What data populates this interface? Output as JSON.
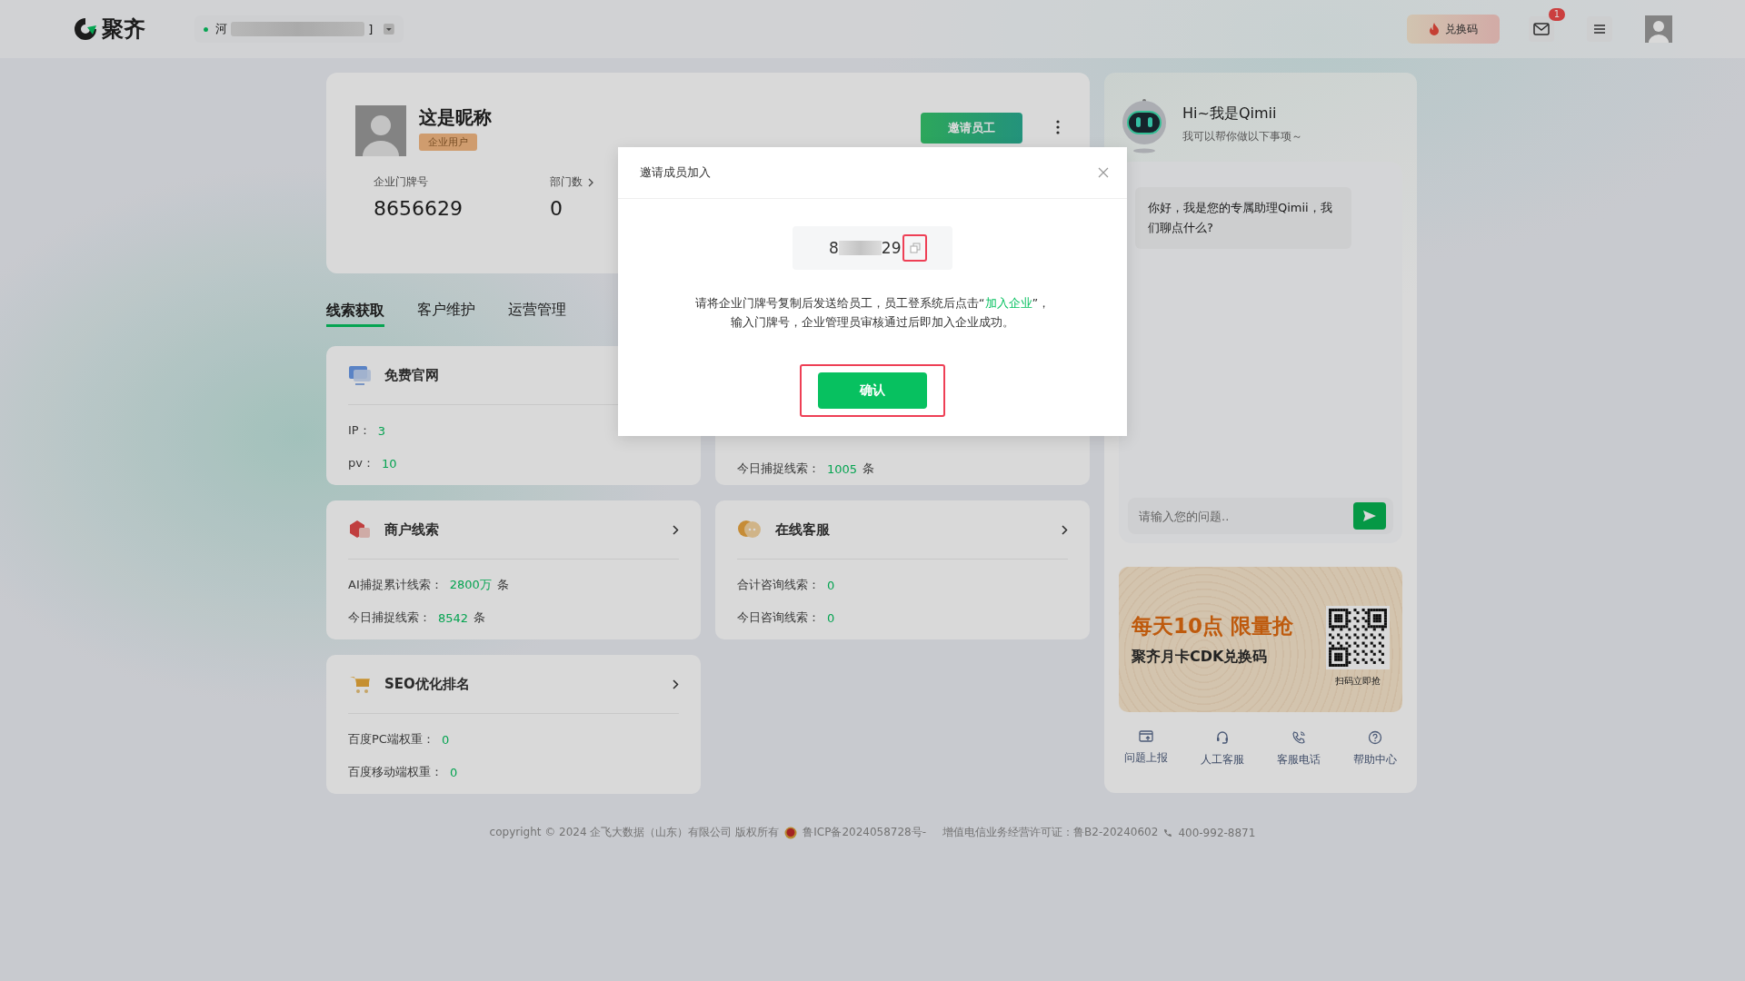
{
  "topbar": {
    "brand": "聚齐",
    "company": {
      "prefix": "河",
      "suffix": "]",
      "redacted": true
    },
    "redeem_button": "兑换码",
    "mail_badge": "1"
  },
  "profile": {
    "name": "这是昵称",
    "badge": "企业用户",
    "invite_button": "邀请员工",
    "stats": [
      {
        "label": "企业门牌号",
        "value": "8656629",
        "kind": "copy"
      },
      {
        "label": "部门数",
        "value": "0",
        "kind": "link"
      }
    ]
  },
  "tabs": [
    {
      "label": "线索获取",
      "selected": true
    },
    {
      "label": "客户维护",
      "selected": false
    },
    {
      "label": "运营管理",
      "selected": false
    }
  ],
  "cards": [
    {
      "title": "免费官网",
      "rows": [
        {
          "label": "IP：",
          "value": "3"
        },
        {
          "label": "pv：",
          "value": "10"
        }
      ]
    },
    {
      "rows": [
        {
          "label": "今日捕捉线索：",
          "value": "1005",
          "unit": "条"
        }
      ]
    },
    {
      "title": "商户线索",
      "chevron": true,
      "rows": [
        {
          "label": "AI捕捉累计线索：",
          "value": "2800万",
          "unit": "条"
        },
        {
          "label": "今日捕捉线索：",
          "value": "8542",
          "unit": "条"
        }
      ]
    },
    {
      "title": "在线客服",
      "chevron": true,
      "rows": [
        {
          "label": "合计咨询线索：",
          "value": "0"
        },
        {
          "label": "今日咨询线索：",
          "value": "0"
        }
      ]
    },
    {
      "title": "SEO优化排名",
      "chevron": true,
      "rows": [
        {
          "label": "百度PC端权重：",
          "value": "0"
        },
        {
          "label": "百度移动端权重：",
          "value": "0"
        }
      ]
    }
  ],
  "assistant": {
    "title": "Hi~我是Qimii",
    "subtitle": "我可以帮你做以下事项～",
    "message": "你好，我是您的专属助理Qimii，我们聊点什么?",
    "input": {
      "placeholder": "请输入您的问题.."
    },
    "banner": {
      "headline": "每天10点 限量抢",
      "subline": "聚齐月卡CDK兑换码",
      "qr_caption": "扫码立即抢"
    },
    "links": [
      {
        "label": "问题上报"
      },
      {
        "label": "人工客服"
      },
      {
        "label": "客服电话"
      },
      {
        "label": "帮助中心"
      }
    ]
  },
  "footer": {
    "copyright": "copyright © 2024 企飞大数据（山东）有限公司 版权所有",
    "icp": "鲁ICP备2024058728号-",
    "license": "增值电信业务经营许可证：鲁B2-20240602",
    "phone": "400-992-8871"
  },
  "dialog": {
    "title": "邀请成员加入",
    "code_start": "8",
    "code_end": "29",
    "code_redacted": true,
    "text_before": "请将企业门牌号复制后发送给员工，员工登系统后点击“",
    "link": "加入企业",
    "text_after": "”，",
    "text_line2": "输入门牌号，企业管理员审核通过后即加入企业成功。",
    "confirm_button": "确认",
    "highlighted": true
  }
}
